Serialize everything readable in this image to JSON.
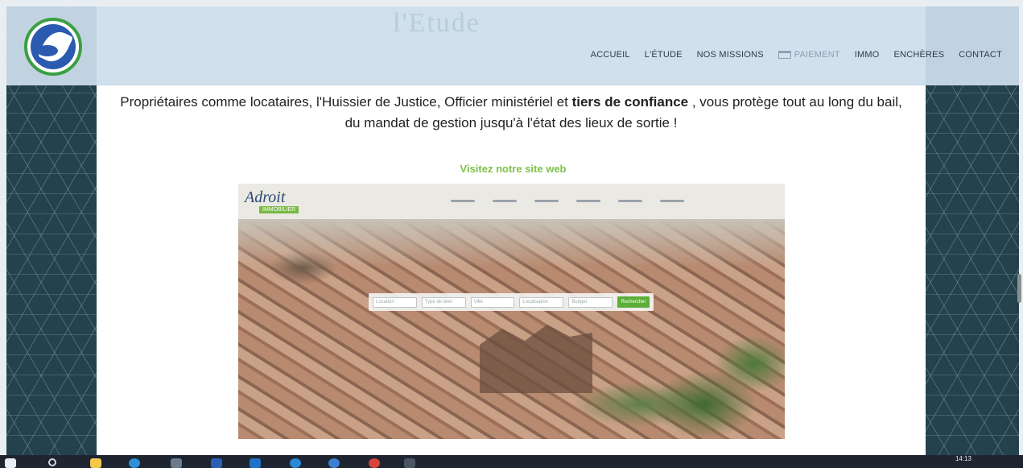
{
  "header": {
    "ghost_title": "l'Etude",
    "menu": [
      {
        "label": "ACCUEIL",
        "muted": false,
        "icon": null
      },
      {
        "label": "L'ÉTUDE",
        "muted": false,
        "icon": null
      },
      {
        "label": "NOS MISSIONS",
        "muted": false,
        "icon": null
      },
      {
        "label": "PAIEMENT",
        "muted": true,
        "icon": "credit-card-icon"
      },
      {
        "label": "IMMO",
        "muted": false,
        "icon": null
      },
      {
        "label": "ENCHÈRES",
        "muted": false,
        "icon": null
      },
      {
        "label": "CONTACT",
        "muted": false,
        "icon": null
      }
    ]
  },
  "intro": {
    "text_before": "Propriétaires comme locataires, l'Huissier de Justice, Officier ministériel et ",
    "bold": "tiers de confiance",
    "text_after": " , vous protège tout au long du bail, du mandat de gestion jusqu'à l'état des lieux de sortie !"
  },
  "visit_link": "Visitez notre site web",
  "preview": {
    "logo_text": "Adroit",
    "logo_sub": "IMMOBILIER",
    "search_fields": [
      "Location",
      "Type de bien",
      "Ville",
      "Localisation",
      "Budget"
    ],
    "search_button": "Rechercher"
  },
  "taskbar": {
    "clock": "14:13"
  },
  "colors": {
    "accent_green": "#7ec04a",
    "nav_bg": "#cedeec",
    "pattern_bg": "#24424c"
  }
}
